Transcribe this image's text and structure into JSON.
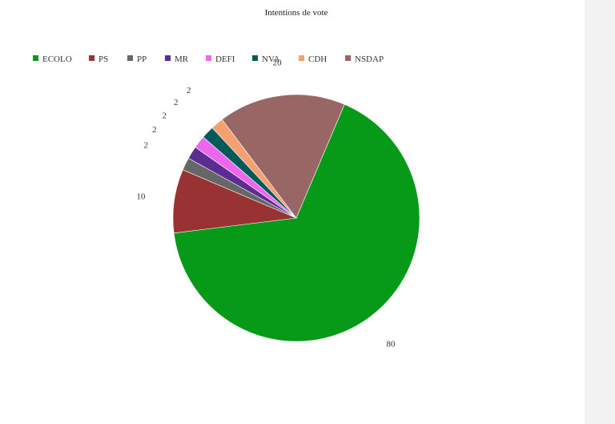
{
  "chart_data": {
    "type": "pie",
    "title": "Intentions de vote",
    "legend_position": "top-left",
    "categories": [
      "ECOLO",
      "PS",
      "PP",
      "MR",
      "DEFI",
      "NVA",
      "CDH",
      "NSDAP"
    ],
    "values": [
      80,
      10,
      2,
      2,
      2,
      2,
      2,
      20
    ],
    "colors": [
      "#069a18",
      "#993333",
      "#666666",
      "#5c2d91",
      "#ee66ee",
      "#005a5a",
      "#f4a070",
      "#996666"
    ]
  }
}
